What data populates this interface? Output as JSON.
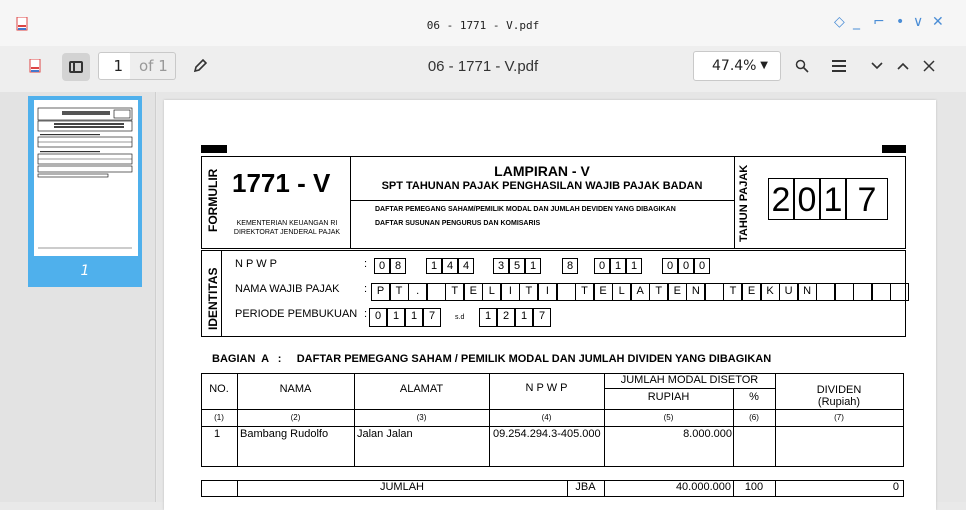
{
  "window": {
    "title": "06 - 1771 - V.pdf",
    "controls": [
      "◇",
      "_",
      "⌐",
      "•",
      "∨",
      "✕"
    ]
  },
  "toolbar": {
    "page_value": "1",
    "page_of": "of 1",
    "document_title": "06 - 1771 - V.pdf",
    "zoom": "47.4%",
    "icons": [
      "pdf-app-icon",
      "sidebar-toggle-icon",
      "annotate-pencil-icon",
      "search-icon",
      "menu-icon",
      "chevron-down-icon",
      "chevron-up-icon",
      "close-icon"
    ]
  },
  "sidebar": {
    "thumb_label": "1"
  },
  "form": {
    "formulir": "FORMULIR",
    "number": "1771 - V",
    "ministry": "KEMENTERIAN KEUANGAN RI",
    "directorate": "DIREKTORAT JENDERAL PAJAK",
    "lampiran": "LAMPIRAN - V",
    "subtitle": "SPT TAHUNAN PAJAK PENGHASILAN WAJIB PAJAK BADAN",
    "desc1": "DAFTAR PEMEGANG SAHAM/PEMILIK MODAL DAN JUMLAH DEVIDEN YANG DIBAGIKAN",
    "desc2": "DAFTAR SUSUNAN PENGURUS DAN KOMISARIS",
    "tahun_pajak_label": "TAHUN PAJAK",
    "year_digits": [
      "2",
      "0",
      "1",
      "7"
    ],
    "identitas": "IDENTITAS",
    "npwp_label": "N P W P",
    "npwp_groups": [
      [
        "0",
        "8"
      ],
      [
        "1",
        "4",
        "4"
      ],
      [
        "3",
        "5",
        "1"
      ],
      [
        "8"
      ],
      [
        "0",
        "1",
        "1"
      ],
      [
        "0",
        "0",
        "0"
      ]
    ],
    "nama_label": "NAMA WAJIB PAJAK",
    "nama_chars": [
      "P",
      "T",
      ".",
      "",
      "T",
      "E",
      "L",
      "I",
      "T",
      "I",
      "",
      "T",
      "E",
      "L",
      "A",
      "T",
      "E",
      "N",
      "",
      "T",
      "E",
      "K",
      "U",
      "N",
      "",
      "",
      "",
      "",
      ""
    ],
    "periode_label": "PERIODE PEMBUKUAN",
    "periode_start": [
      "0",
      "1",
      "1",
      "7"
    ],
    "sd": "s.d",
    "periode_end": [
      "1",
      "2",
      "1",
      "7"
    ],
    "colon": ":"
  },
  "section_a": {
    "title": "BAGIAN  A   :     DAFTAR PEMEGANG SAHAM / PEMILIK MODAL DAN JUMLAH DIVIDEN YANG DIBAGIKAN",
    "headers": {
      "no": "NO.",
      "nama": "NAMA",
      "alamat": "ALAMAT",
      "npwp": "N P W P",
      "modal": "JUMLAH MODAL DISETOR",
      "rupiah": "RUPIAH",
      "percent": "%",
      "dividen": "DIVIDEN",
      "dividen_sub": "(Rupiah)"
    },
    "col_numbers": [
      "(1)",
      "(2)",
      "(3)",
      "(4)",
      "(5)",
      "(6)",
      "(7)"
    ],
    "rows": [
      {
        "no": "1",
        "nama": "Bambang Rudolfo",
        "alamat": "Jalan Jalan",
        "npwp": "09.254.294.3-405.000",
        "rupiah": "8.000.000",
        "percent": "",
        "dividen": ""
      }
    ],
    "total": {
      "label": "JUMLAH",
      "code": "JBA",
      "rupiah": "40.000.000",
      "percent": "100",
      "dividen": "0"
    }
  }
}
